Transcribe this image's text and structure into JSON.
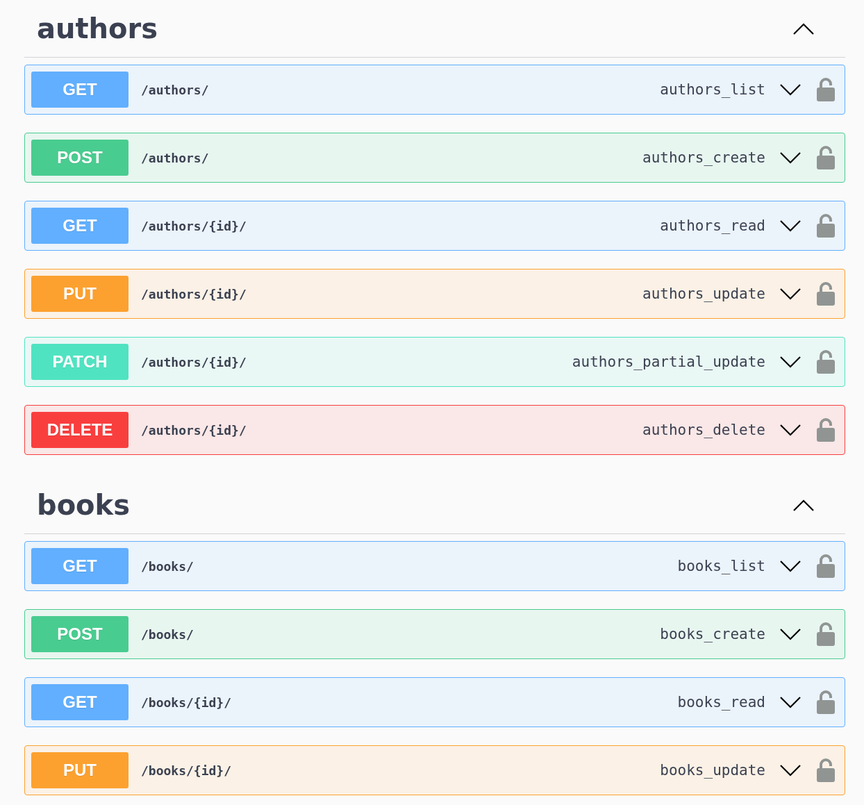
{
  "sections": [
    {
      "title": "authors",
      "expanded": true,
      "operations": [
        {
          "kind": "get",
          "method": "GET",
          "path": "/authors/",
          "summary": "authors_list",
          "expanded": false
        },
        {
          "kind": "post",
          "method": "POST",
          "path": "/authors/",
          "summary": "authors_create",
          "expanded": false
        },
        {
          "kind": "get",
          "method": "GET",
          "path": "/authors/{id}/",
          "summary": "authors_read",
          "expanded": false
        },
        {
          "kind": "put",
          "method": "PUT",
          "path": "/authors/{id}/",
          "summary": "authors_update",
          "expanded": false
        },
        {
          "kind": "patch",
          "method": "PATCH",
          "path": "/authors/{id}/",
          "summary": "authors_partial_update",
          "expanded": false
        },
        {
          "kind": "delete",
          "method": "DELETE",
          "path": "/authors/{id}/",
          "summary": "authors_delete",
          "expanded": false
        }
      ]
    },
    {
      "title": "books",
      "expanded": true,
      "operations": [
        {
          "kind": "get",
          "method": "GET",
          "path": "/books/",
          "summary": "books_list",
          "expanded": false
        },
        {
          "kind": "post",
          "method": "POST",
          "path": "/books/",
          "summary": "books_create",
          "expanded": false
        },
        {
          "kind": "get",
          "method": "GET",
          "path": "/books/{id}/",
          "summary": "books_read",
          "expanded": false
        },
        {
          "kind": "put",
          "method": "PUT",
          "path": "/books/{id}/",
          "summary": "books_update",
          "expanded": false
        }
      ]
    }
  ]
}
